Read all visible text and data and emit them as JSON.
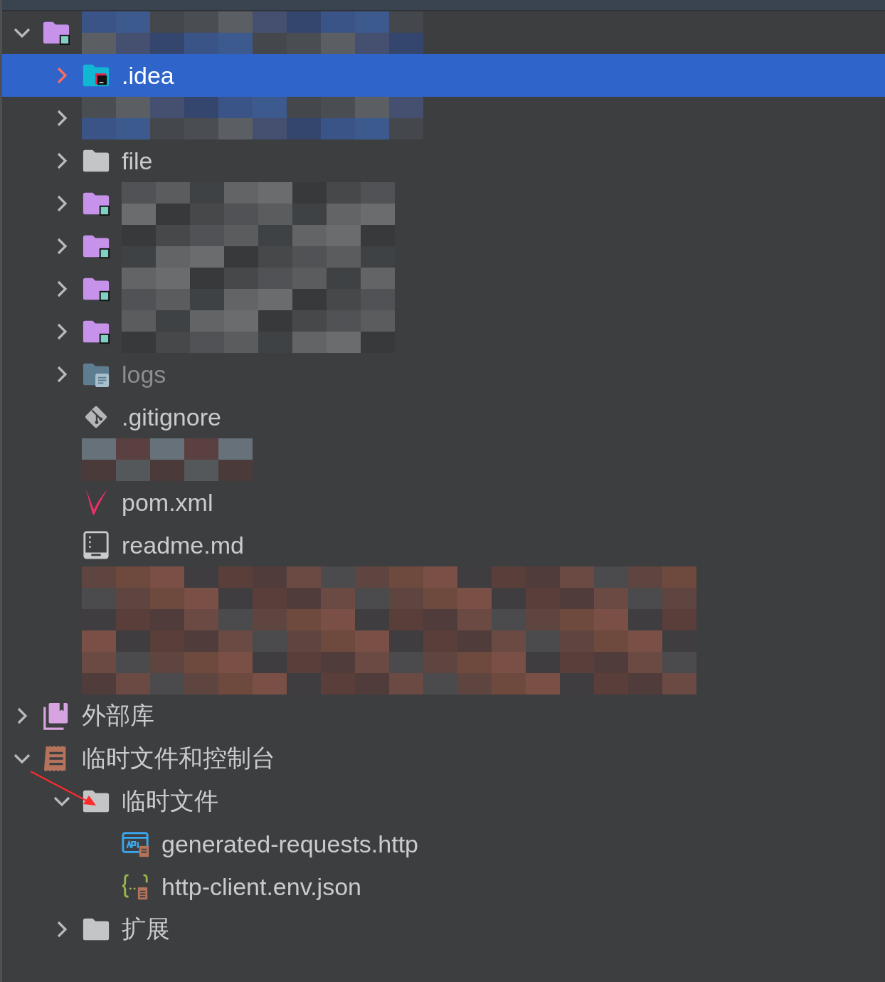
{
  "tree": [
    {
      "kind": "module",
      "expanded": true,
      "selected": false,
      "children": [
        {
          "label": ".idea",
          "kind": "idea",
          "expanded": false,
          "selected": true
        },
        {
          "kind": "hidden",
          "expanded": false,
          "selected": false
        },
        {
          "label": "file",
          "kind": "folder",
          "expanded": false,
          "selected": false
        },
        {
          "kind": "module",
          "expanded": false,
          "selected": false
        },
        {
          "kind": "module",
          "expanded": false,
          "selected": false
        },
        {
          "kind": "module",
          "expanded": false,
          "selected": false
        },
        {
          "kind": "module",
          "expanded": false,
          "selected": false
        },
        {
          "label": "logs",
          "kind": "logs",
          "dimmed": true,
          "expanded": false,
          "selected": false
        },
        {
          "label": ".gitignore",
          "kind": "git",
          "selected": false
        },
        {
          "kind": "hidden",
          "selected": false
        },
        {
          "label": "pom.xml",
          "kind": "maven",
          "selected": false
        },
        {
          "label": "readme.md",
          "kind": "readme",
          "selected": false
        },
        {
          "kind": "hidden",
          "selected": false
        },
        {
          "kind": "hidden",
          "selected": false
        },
        {
          "kind": "hidden",
          "selected": false
        }
      ]
    },
    {
      "label": "外部库",
      "kind": "library",
      "expanded": false,
      "selected": false
    },
    {
      "label": "临时文件和控制台",
      "kind": "scratches",
      "expanded": true,
      "selected": false,
      "children": [
        {
          "label": "临时文件",
          "kind": "folder",
          "expanded": true,
          "selected": false,
          "children": [
            {
              "label": "generated-requests.http",
              "kind": "http",
              "selected": false
            },
            {
              "label": "http-client.env.json",
              "kind": "json",
              "selected": false
            }
          ]
        },
        {
          "label": "扩展",
          "kind": "folder",
          "expanded": false,
          "selected": false
        }
      ]
    }
  ],
  "annotations": [
    {
      "kind": "arrow",
      "color": "#ff2a2a"
    }
  ]
}
